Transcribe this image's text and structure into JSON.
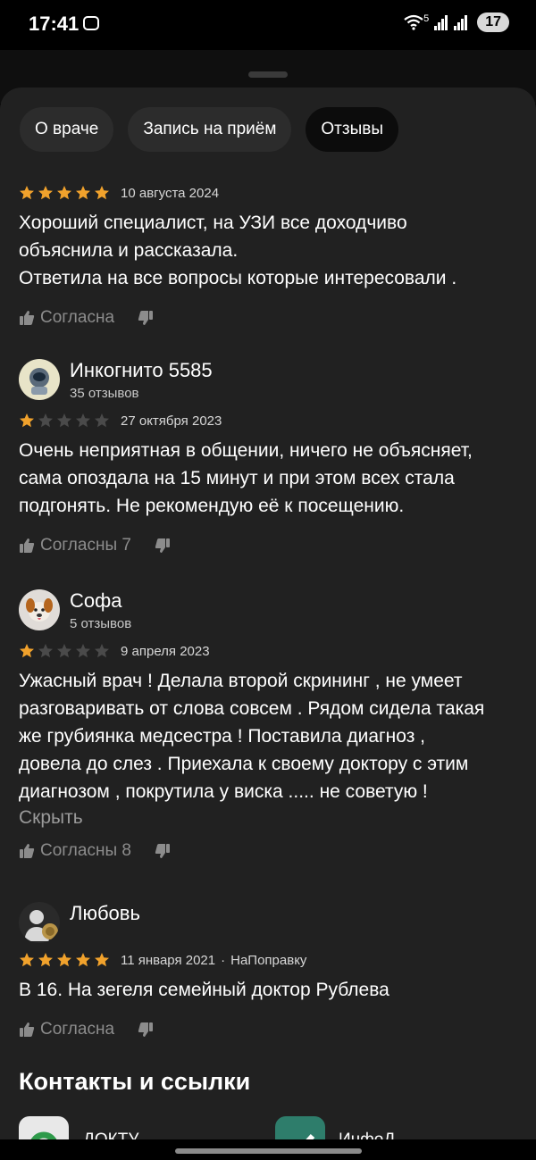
{
  "status_bar": {
    "time": "17:41",
    "network": "5",
    "battery": "17"
  },
  "tabs": [
    {
      "label": "О враче",
      "active": false
    },
    {
      "label": "Запись на приём",
      "active": false
    },
    {
      "label": "Отзывы",
      "active": true
    }
  ],
  "reviews": [
    {
      "rating": 5,
      "date": "10 августа 2024",
      "text": "Хороший специалист, на УЗИ все доходчиво\nобъяснила и рассказала.\nОтветила на все вопросы которые интересовали .",
      "like_label": "Согласна"
    },
    {
      "author": "Инкогнито 5585",
      "review_count": "35 отзывов",
      "avatar_icon": "astronaut-icon",
      "rating": 1,
      "date": "27 октября 2023",
      "text": "Очень неприятная в общении, ничего не объясняет,\nсама опоздала на 15 минут и при этом всех стала\nподгонять. Не рекомендую её к посещению.",
      "like_label": "Согласны 7"
    },
    {
      "author": "Софа",
      "review_count": "5 отзывов",
      "avatar_icon": "dog-icon",
      "rating": 1,
      "date": "9 апреля 2023",
      "text": "Ужасный врач ! Делала второй скрининг , не умеет\nразговаривать от слова совсем . Рядом сидела такая\nже грубиянка медсестра ! Поставила диагноз ,\nдовела до слез . Приехала к своему доктору с этим\nдиагнозом , покрутила у виска ..... не советую !",
      "collapse_label": "Скрыть",
      "like_label": "Согласны 8"
    },
    {
      "author": "Любовь",
      "avatar_icon": "user-silhouette-icon",
      "rating": 5,
      "date": "11 января 2021",
      "source": "НаПоправку",
      "text": "В 16. На зегеля семейный доктор Рублева",
      "like_label": "Согласна"
    }
  ],
  "contacts": {
    "title": "Контакты и ссылки",
    "items": [
      {
        "label": "ДОКТУ",
        "color": "#ffffff"
      },
      {
        "label": "ИнфоД",
        "color": "#2e7d6b"
      }
    ]
  },
  "colors": {
    "star_filled": "#f1a22c",
    "star_empty": "#4a4a4a",
    "sheet_bg": "#212121"
  }
}
